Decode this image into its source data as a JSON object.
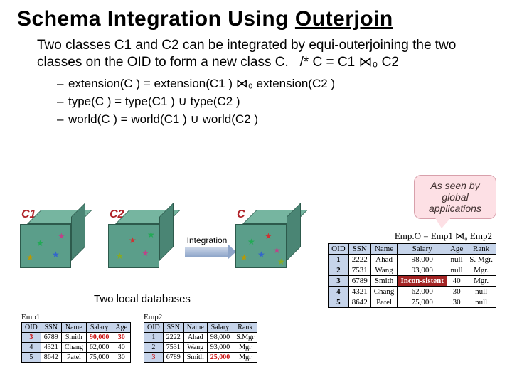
{
  "title_plain": "Schema Integration Using ",
  "title_under": "Outerjoin",
  "body": "Two classes C1 and C2 can be integrated by equi-outerjoining the two classes on the OID to form a new class C.   /* C = C1 ⋈₀ C2",
  "bullets": [
    "extension(C ) = extension(C1 ) ⋈₀ extension(C2 )",
    "type(C ) = type(C1 ) ∪ type(C2 )",
    "world(C ) = world(C1 ) ∪ world(C2 )"
  ],
  "cube_labels": {
    "c1": "C1",
    "c2": "C2",
    "c": "C"
  },
  "arrow_label": "Integration",
  "callout": "As seen by global applications",
  "local_label": "Two local databases",
  "emp_o_eq": "Emp.O = Emp1 ⋈₀ Emp2",
  "emp1": {
    "caption": "Emp1",
    "headers": [
      "OID",
      "SSN",
      "Name",
      "Salary",
      "Age"
    ],
    "rows": [
      [
        "3",
        "6789",
        "Smith",
        "90,000",
        "30"
      ],
      [
        "4",
        "4321",
        "Chang",
        "62,000",
        "40"
      ],
      [
        "5",
        "8642",
        "Patel",
        "75,000",
        "30"
      ]
    ]
  },
  "emp2": {
    "caption": "Emp2",
    "headers": [
      "OID",
      "SSN",
      "Name",
      "Salary",
      "Rank"
    ],
    "rows": [
      [
        "1",
        "2222",
        "Ahad",
        "98,000",
        "S.Mgr"
      ],
      [
        "2",
        "7531",
        "Wang",
        "93,000",
        "Mgr"
      ],
      [
        "3",
        "6789",
        "Smith",
        "25,000",
        "Mgr"
      ]
    ]
  },
  "empo": {
    "headers": [
      "OID",
      "SSN",
      "Name",
      "Salary",
      "Age",
      "Rank"
    ],
    "rows": [
      [
        "1",
        "2222",
        "Ahad",
        "98,000",
        "null",
        "S. Mgr."
      ],
      [
        "2",
        "7531",
        "Wang",
        "93,000",
        "null",
        "Mgr."
      ],
      [
        "3",
        "6789",
        "Smith",
        "Incon-sistent",
        "40",
        "Mgr."
      ],
      [
        "4",
        "4321",
        "Chang",
        "62,000",
        "30",
        "null"
      ],
      [
        "5",
        "8642",
        "Patel",
        "75,000",
        "30",
        "null"
      ]
    ]
  },
  "chart_data": {
    "type": "table",
    "title": "Outerjoin of Emp1 and Emp2 on OID producing Emp.O",
    "tables": {
      "Emp1": {
        "columns": [
          "OID",
          "SSN",
          "Name",
          "Salary",
          "Age"
        ],
        "rows": [
          [
            3,
            6789,
            "Smith",
            90000,
            30
          ],
          [
            4,
            4321,
            "Chang",
            62000,
            40
          ],
          [
            5,
            8642,
            "Patel",
            75000,
            30
          ]
        ]
      },
      "Emp2": {
        "columns": [
          "OID",
          "SSN",
          "Name",
          "Salary",
          "Rank"
        ],
        "rows": [
          [
            1,
            2222,
            "Ahad",
            98000,
            "S.Mgr"
          ],
          [
            2,
            7531,
            "Wang",
            93000,
            "Mgr"
          ],
          [
            3,
            6789,
            "Smith",
            25000,
            "Mgr"
          ]
        ]
      },
      "Emp.O": {
        "columns": [
          "OID",
          "SSN",
          "Name",
          "Salary",
          "Age",
          "Rank"
        ],
        "rows": [
          [
            1,
            2222,
            "Ahad",
            98000,
            null,
            "S. Mgr."
          ],
          [
            2,
            7531,
            "Wang",
            93000,
            null,
            "Mgr."
          ],
          [
            3,
            6789,
            "Smith",
            "Inconsistent",
            40,
            "Mgr."
          ],
          [
            4,
            4321,
            "Chang",
            62000,
            30,
            null
          ],
          [
            5,
            8642,
            "Patel",
            75000,
            30,
            null
          ]
        ]
      }
    }
  }
}
